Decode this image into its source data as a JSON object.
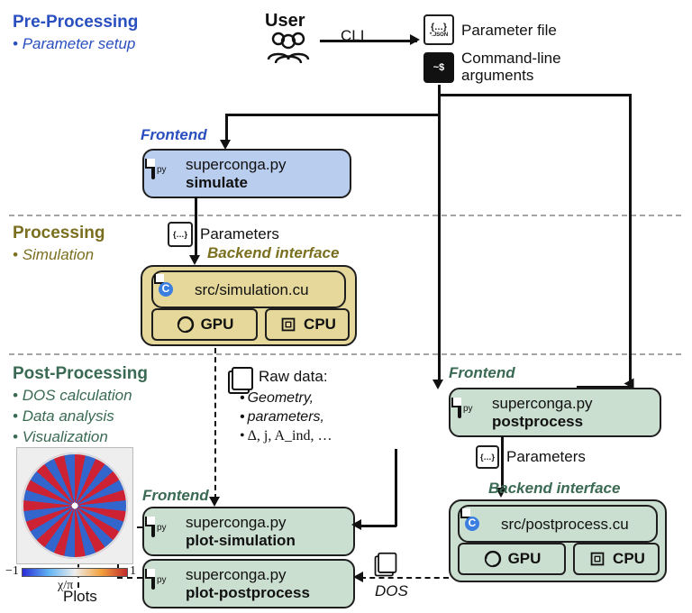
{
  "sections": {
    "pre": {
      "title": "Pre-Processing",
      "sub1": "Parameter setup"
    },
    "proc": {
      "title": "Processing",
      "sub1": "Simulation"
    },
    "post": {
      "title": "Post-Processing",
      "sub1": "DOS calculation",
      "sub2": "Data analysis",
      "sub3": "Visualization"
    }
  },
  "user": {
    "title": "User",
    "cli": "CLI"
  },
  "inputs": {
    "param_file": "Parameter file",
    "cmd_args": "Command-line arguments",
    "json_tag": "*.JSON",
    "term_tag": "~$"
  },
  "labels": {
    "frontend": "Frontend",
    "backend_iface": "Backend interface",
    "parameters": "Parameters",
    "raw_header": "Raw data:",
    "dos": "DOS",
    "plots": "Plots",
    "gpu": "GPU",
    "cpu": "CPU"
  },
  "nodes": {
    "simulate": {
      "line1": "superconga.py",
      "line2": "simulate"
    },
    "sim_cu": {
      "line1": "src/simulation.cu"
    },
    "postprocess": {
      "line1": "superconga.py",
      "line2": "postprocess"
    },
    "plot_sim": {
      "line1": "superconga.py",
      "line2": "plot-simulation"
    },
    "plot_post": {
      "line1": "superconga.py",
      "line2": "plot-postprocess"
    },
    "post_cu": {
      "line1": "src/postprocess.cu"
    }
  },
  "raw_items": {
    "a": "Geometry,",
    "b": "parameters,",
    "c": "Δ, j, A_ind, …"
  },
  "colorbar": {
    "left": "−1",
    "center": "χ/π",
    "right": "1"
  }
}
